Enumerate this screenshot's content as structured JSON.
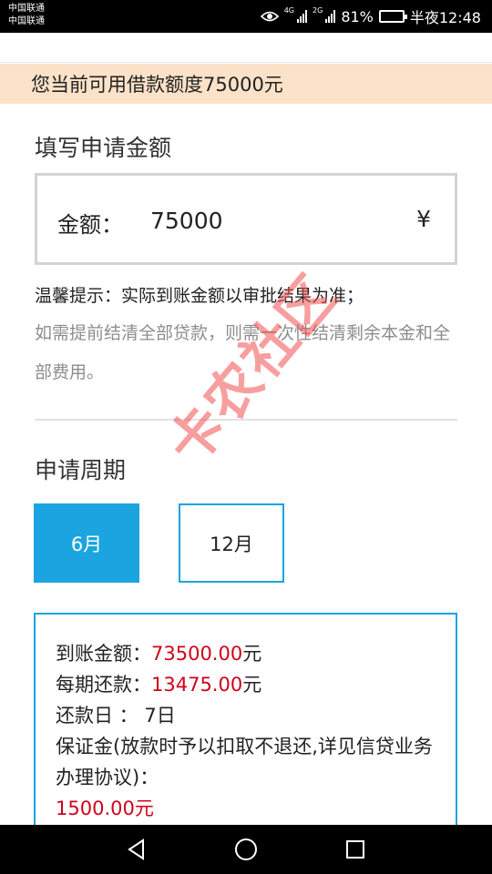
{
  "status_bar": {
    "carrier_1": "中国联通",
    "carrier_2": "中国联通",
    "sim1_network": "4G",
    "sim2_network": "2G",
    "battery_percent": "81%",
    "battery_level": 0.81,
    "time": "半夜12:48"
  },
  "banner": {
    "text": "您当前可用借款额度75000元"
  },
  "amount_section": {
    "title": "填写申请金额",
    "label": "金额：",
    "value": "75000",
    "currency": "¥"
  },
  "tips": {
    "line1": "温馨提示：实际到账金额以审批结果为准；",
    "line2": "如需提前结清全部贷款，则需一次性结清剩余本金和全部费用。"
  },
  "period_section": {
    "title": "申请周期",
    "options": [
      {
        "label": "6月",
        "selected": true
      },
      {
        "label": "12月",
        "selected": false
      }
    ]
  },
  "result": {
    "received_label": "到账金额：",
    "received_value": "73500.00",
    "received_unit": "元",
    "installment_label": "每期还款：",
    "installment_value": "13475.00",
    "installment_unit": "元",
    "repay_day_label": "还款日 ：",
    "repay_day_value": "7日",
    "deposit_label": "保证金(放款时予以扣取不退还,详见信贷业务办理协议)：",
    "deposit_value": "1500.00",
    "deposit_unit": "元"
  },
  "watermark": "卡农社区",
  "colors": {
    "accent": "#1ba4e0",
    "banner_bg": "#fbe2c8",
    "highlight_red": "#d0021b"
  },
  "icons": {
    "eye": "eye-icon",
    "signal": "signal-icon",
    "battery": "battery-icon",
    "back": "back-icon",
    "home": "home-icon",
    "recent": "recent-apps-icon"
  }
}
